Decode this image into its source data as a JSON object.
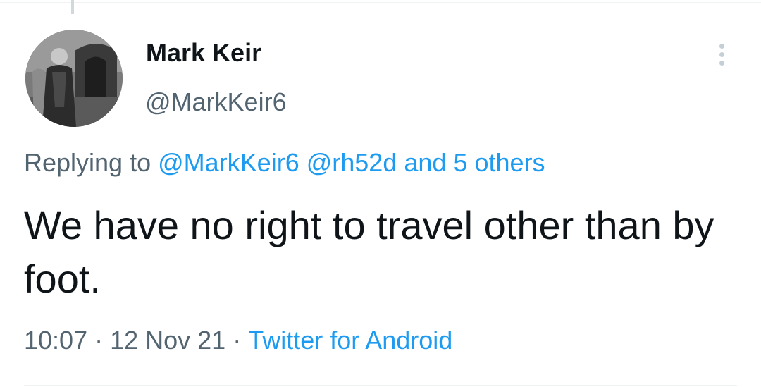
{
  "author": {
    "display_name": "Mark Keir",
    "handle": "@MarkKeir6",
    "avatar_icon": "profile-photo-avatar"
  },
  "more_icon": "more-vertical-icon",
  "reply": {
    "prefix": "Replying to",
    "mention_1": "@MarkKeir6",
    "mention_2": "@rh52d",
    "others": "and 5 others"
  },
  "tweet": {
    "text": "We have no right to travel other than by foot."
  },
  "meta": {
    "time": "10:07",
    "separator": "·",
    "date": "12 Nov 21",
    "source": "Twitter for Android"
  },
  "colors": {
    "link": "#1d9bf0",
    "secondary_text": "#536471",
    "primary_text": "#0f1419"
  }
}
